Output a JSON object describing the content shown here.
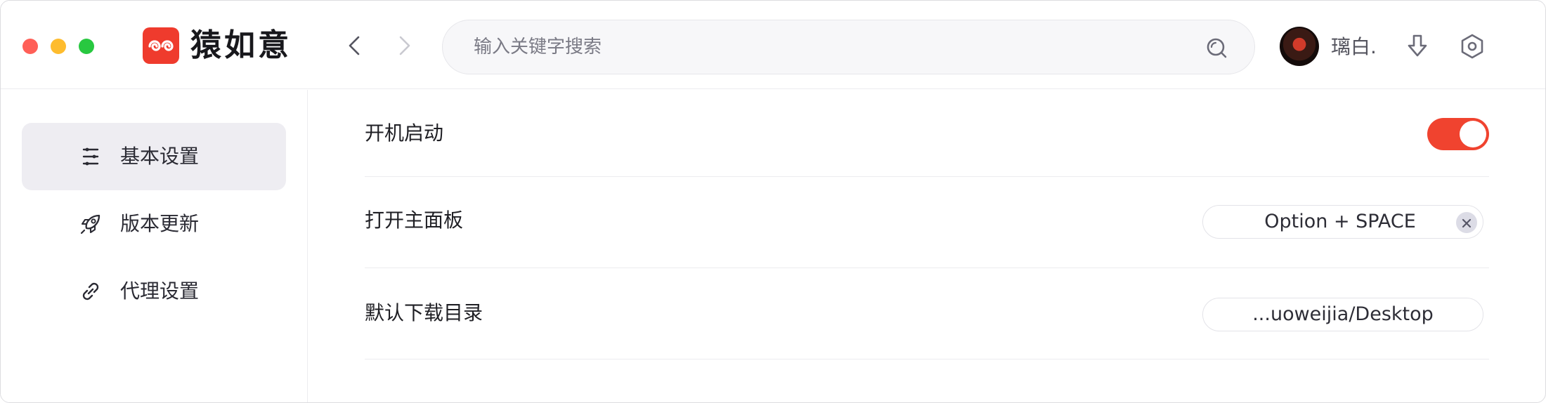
{
  "app": {
    "name": "猿如意",
    "accent_color": "#f0432f"
  },
  "header": {
    "search": {
      "placeholder": "输入关键字搜索",
      "value": ""
    },
    "user": {
      "name": "璃白."
    },
    "icons": [
      "chevron-left-icon",
      "chevron-right-icon",
      "search-icon",
      "download-icon",
      "settings-icon"
    ]
  },
  "sidebar": {
    "items": [
      {
        "label": "基本设置",
        "icon": "sliders-icon",
        "active": true
      },
      {
        "label": "版本更新",
        "icon": "rocket-icon",
        "active": false
      },
      {
        "label": "代理设置",
        "icon": "link-icon",
        "active": false
      }
    ]
  },
  "settings": {
    "launch_at_startup": {
      "label": "开机启动",
      "enabled": true
    },
    "open_panel": {
      "label": "打开主面板",
      "shortcut": "Option + SPACE"
    },
    "download_dir": {
      "label": "默认下载目录",
      "path": "...uoweijia/Desktop"
    }
  }
}
